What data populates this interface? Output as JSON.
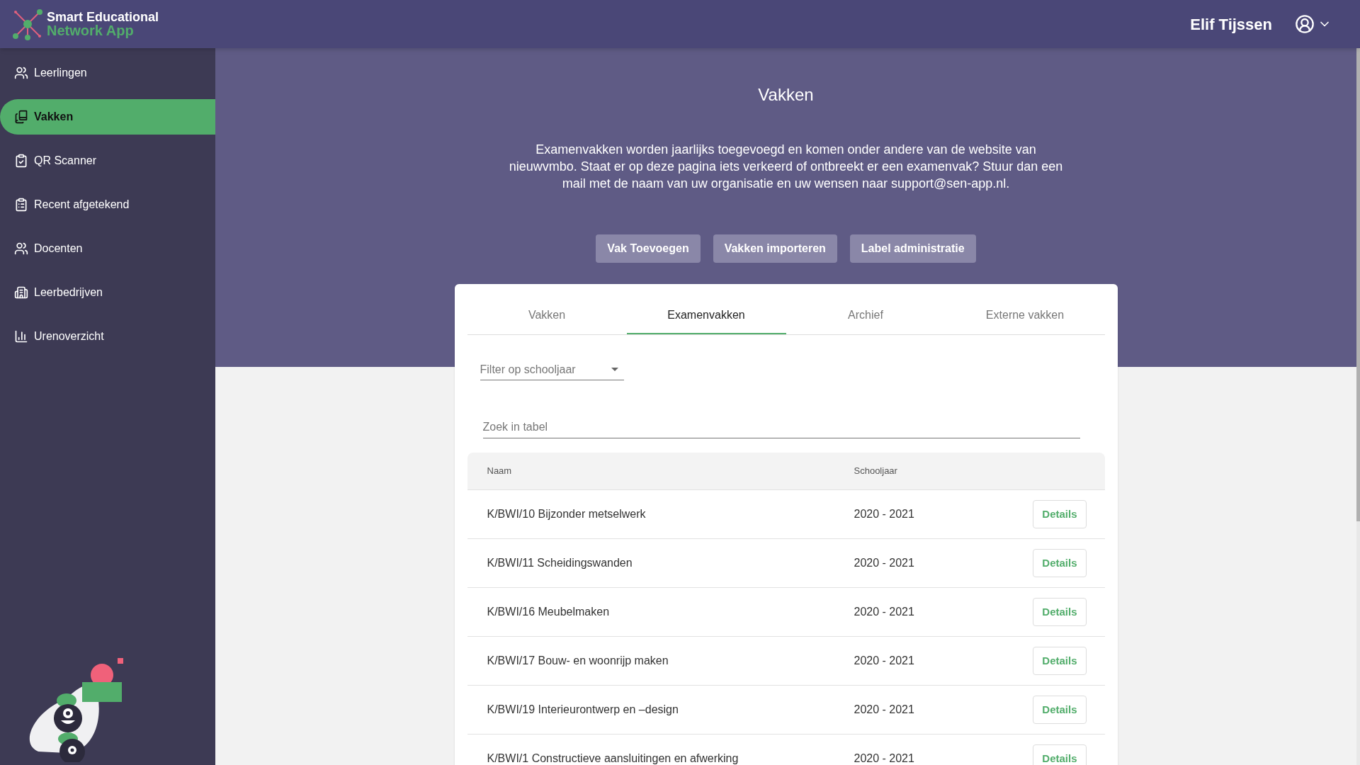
{
  "app": {
    "logo_line_1": "Smart Educational",
    "logo_line_2": "Network App"
  },
  "header": {
    "user_name": "Elif Tijssen"
  },
  "sidebar": {
    "items": [
      {
        "label": "Leerlingen",
        "selected": false
      },
      {
        "label": "Vakken",
        "selected": true
      },
      {
        "label": "QR Scanner",
        "selected": false
      },
      {
        "label": "Recent afgetekend",
        "selected": false
      },
      {
        "label": "Docenten",
        "selected": false
      },
      {
        "label": "Leerbedrijven",
        "selected": false
      },
      {
        "label": "Urenoverzicht",
        "selected": false
      }
    ]
  },
  "page": {
    "title": "Vakken",
    "intro": "Examenvakken worden jaarlijks toegevoegd en komen onder andere van de website van nieuwvmbo. Staat er op deze pagina iets verkeerd of ontbreekt er een examenvak? Stuur dan een mail met de naam van uw organisatie en uw wensen naar support@sen-app.nl.",
    "buttons": [
      "Vak Toevoegen",
      "Vakken importeren",
      "Label administratie"
    ]
  },
  "tabs": [
    {
      "label": "Vakken",
      "selected": false
    },
    {
      "label": "Examenvakken",
      "selected": true
    },
    {
      "label": "Archief",
      "selected": false
    },
    {
      "label": "Externe vakken",
      "selected": false
    }
  ],
  "filter": {
    "placeholder": "Filter op schooljaar"
  },
  "search": {
    "placeholder": "Zoek in tabel"
  },
  "table": {
    "columns": [
      "Naam",
      "Schooljaar"
    ],
    "rows": [
      {
        "name": "K/BWI/10 Bijzonder metselwerk",
        "year": "2020 - 2021",
        "action": "Details"
      },
      {
        "name": "K/BWI/11 Scheidingswanden",
        "year": "2020 - 2021",
        "action": "Details"
      },
      {
        "name": "K/BWI/16 Meubelmaken",
        "year": "2020 - 2021",
        "action": "Details"
      },
      {
        "name": "K/BWI/17 Bouw- en woonrijp maken",
        "year": "2020 - 2021",
        "action": "Details"
      },
      {
        "name": "K/BWI/19 Interieurontwerp en –design",
        "year": "2020 - 2021",
        "action": "Details"
      },
      {
        "name": "K/BWI/1 Constructieve aansluitingen en afwerking",
        "year": "2020 - 2021",
        "action": "Details"
      }
    ]
  }
}
